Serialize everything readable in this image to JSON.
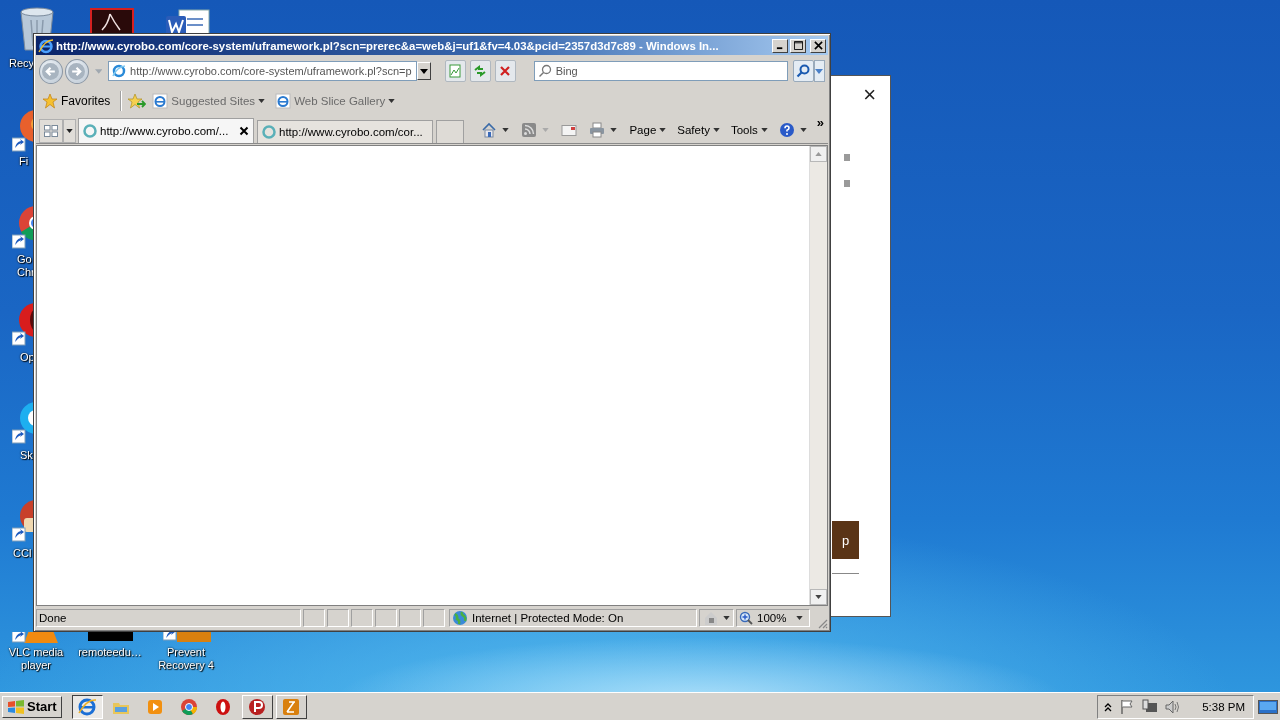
{
  "desktop": {
    "icons": [
      {
        "kind": "recycle",
        "label": [
          "Recy"
        ]
      },
      {
        "kind": "pdf"
      },
      {
        "kind": "word"
      },
      {
        "kind": "firefox",
        "label": [
          "Fi"
        ]
      },
      {
        "kind": "chrome",
        "label": [
          "Go",
          "Chr"
        ]
      },
      {
        "kind": "opera",
        "label": [
          "Op"
        ]
      },
      {
        "kind": "skype",
        "label": [
          "Sk"
        ]
      },
      {
        "kind": "ccleaner",
        "label": [
          "CCl"
        ]
      },
      {
        "kind": "vlc",
        "label": [
          "VLC media player"
        ]
      },
      {
        "kind": "remote",
        "label": [
          "remoteedu…"
        ]
      },
      {
        "kind": "prevent",
        "label": [
          "Prevent Recovery 4"
        ]
      }
    ]
  },
  "popup": {
    "close": "×",
    "button": "p"
  },
  "browser": {
    "title": "http://www.cyrobo.com/core-system/uframework.pl?scn=prerec&a=web&j=uf1&fv=4.03&pcid=2357d3d7c89 - Windows In...",
    "address": "http://www.cyrobo.com/core-system/uframework.pl?scn=p",
    "search": {
      "placeholder": "Bing"
    },
    "favorites": "Favorites",
    "favorites_bar": [
      "Suggested Sites",
      "Web Slice Gallery"
    ],
    "tabs": [
      {
        "label": "http://www.cyrobo.com/...",
        "selected": true
      },
      {
        "label": "http://www.cyrobo.com/cor...",
        "selected": false
      }
    ],
    "command_bar": [
      "Page",
      "Safety",
      "Tools"
    ],
    "more": "»",
    "status": {
      "text": "Done",
      "zone": "Internet | Protected Mode: On",
      "zoom": "100%"
    }
  },
  "taskbar": {
    "start": "Start",
    "apps": [
      {
        "kind": "ie",
        "open": true,
        "selected": true
      },
      {
        "kind": "explorer",
        "open": false,
        "selected": false
      },
      {
        "kind": "media",
        "open": false,
        "selected": false
      },
      {
        "kind": "chrome",
        "open": false,
        "selected": false
      },
      {
        "kind": "opera",
        "open": false,
        "selected": false
      },
      {
        "kind": "p-red",
        "open": true,
        "selected": false
      },
      {
        "kind": "p-orange",
        "open": true,
        "selected": false
      }
    ],
    "clock": "5:38 PM"
  }
}
